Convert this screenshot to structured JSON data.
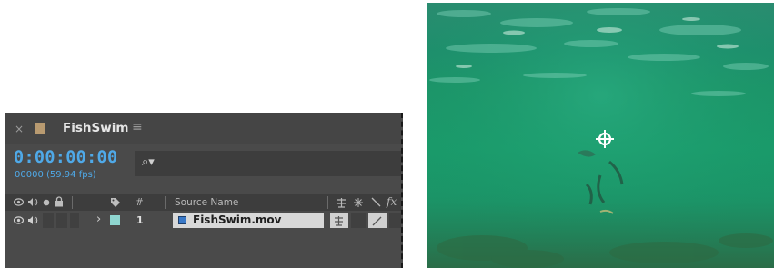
{
  "timeline": {
    "close_glyph": "×",
    "comp_name": "FishSwim",
    "menu_glyph": "≡",
    "timecode": "0:00:00:00",
    "frames": "00000 (59.94 fps)",
    "search": {
      "icon": "search-icon",
      "glyph": "⌕▾",
      "value": ""
    },
    "columns": {
      "number": "#",
      "source_name": "Source Name"
    },
    "layers": [
      {
        "number": "1",
        "source_name": "FishSwim.mov",
        "label_color": "#8fd6d0",
        "chevron": "›"
      }
    ],
    "accent_color": "#4fa9e8",
    "comp_color": "#b89a70"
  },
  "preview": {
    "description_icon": "anchor-point-icon",
    "water_color": "#1c9468"
  }
}
